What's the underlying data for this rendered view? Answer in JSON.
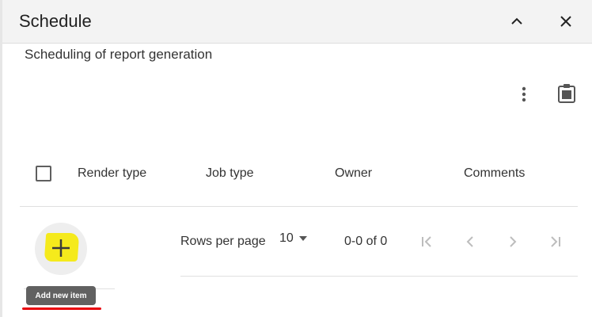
{
  "header": {
    "title": "Schedule"
  },
  "subtitle": "Scheduling of report generation",
  "icons": {
    "collapse": "chevron-up-icon",
    "close": "close-icon",
    "more": "more-vertical-icon",
    "clipboard": "clipboard-icon",
    "add": "plus-icon",
    "first": "first-page-icon",
    "prev": "chevron-left-icon",
    "next": "chevron-right-icon",
    "last": "last-page-icon"
  },
  "table": {
    "columns": [
      "Render type",
      "Job type",
      "Owner",
      "Comments"
    ],
    "rows": []
  },
  "add_tooltip": "Add new item",
  "pagination": {
    "rows_per_page_label": "Rows per page",
    "rows_per_page_value": "10",
    "range": "0-0 of 0"
  },
  "colors": {
    "highlight": "#f5ea1c",
    "annotation_underline": "#e8000b",
    "header_bg": "#f3f3f3",
    "tooltip_bg": "#616161"
  }
}
